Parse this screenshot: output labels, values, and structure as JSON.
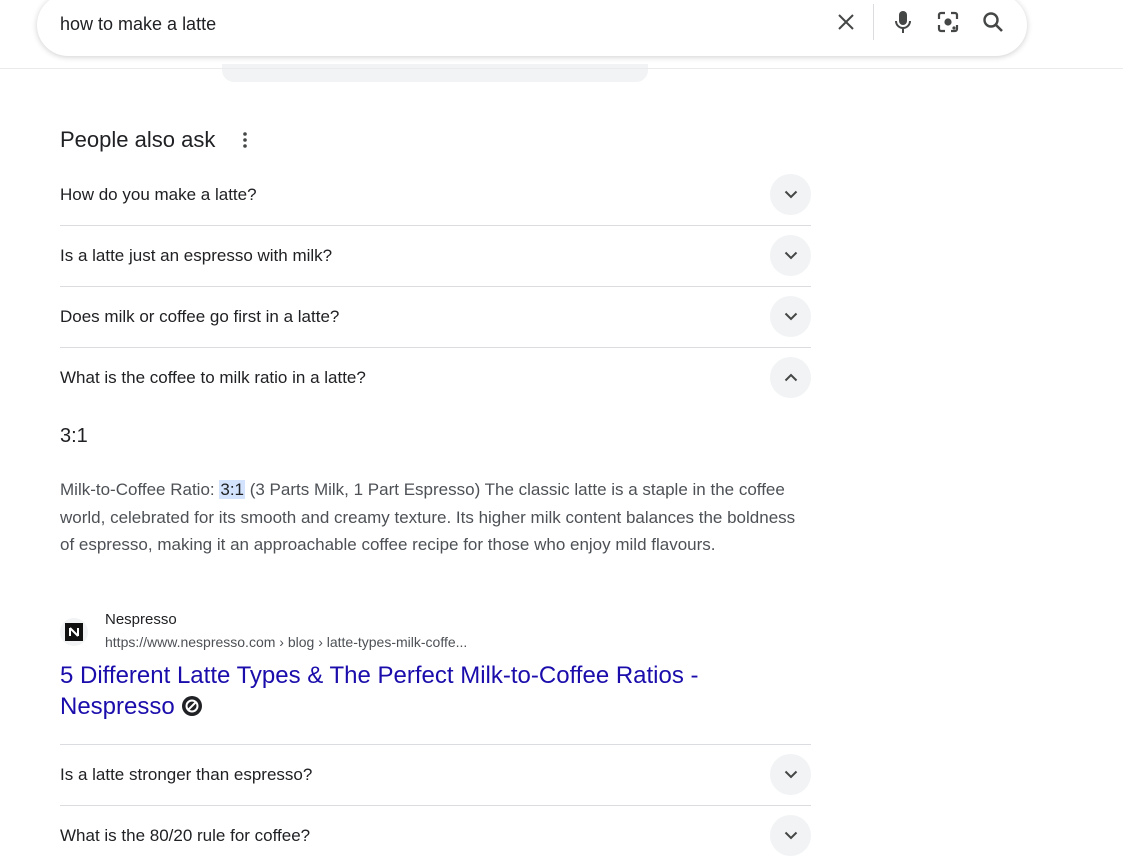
{
  "search": {
    "query": "how to make a latte"
  },
  "icons": {
    "clear": "close-icon",
    "voice": "microphone-icon",
    "lens": "camera-lens-icon",
    "search": "search-icon",
    "more": "more-vert-icon",
    "expand": "chevron-down-icon",
    "collapse": "chevron-up-icon"
  },
  "paa": {
    "title": "People also ask",
    "questions": [
      {
        "text": "How do you make a latte?",
        "expanded": false
      },
      {
        "text": "Is a latte just an espresso with milk?",
        "expanded": false
      },
      {
        "text": "Does milk or coffee go first in a latte?",
        "expanded": false
      },
      {
        "text": "What is the coffee to milk ratio in a latte?",
        "expanded": true
      },
      {
        "text": "Is a latte stronger than espresso?",
        "expanded": false
      },
      {
        "text": "What is the 80/20 rule for coffee?",
        "expanded": false
      }
    ],
    "answer": {
      "short": "3:1",
      "prefix": "Milk-to-Coffee Ratio: ",
      "highlight": "3:1",
      "rest": " (3 Parts Milk, 1 Part Espresso) The classic latte is a staple in the coffee world, celebrated for its smooth and creamy texture. Its higher milk content balances the boldness of espresso, making it an approachable coffee recipe for those who enjoy mild flavours.",
      "source_name": "Nespresso",
      "source_url": "https://www.nespresso.com › blog › latte-types-milk-coffe...",
      "result_title": "5 Different Latte Types & The Perfect Milk-to-Coffee Ratios - Nespresso"
    }
  },
  "colors": {
    "link": "#1a0dab",
    "highlight": "#d3e3fd",
    "chevron_bg": "#f1f3f4"
  }
}
